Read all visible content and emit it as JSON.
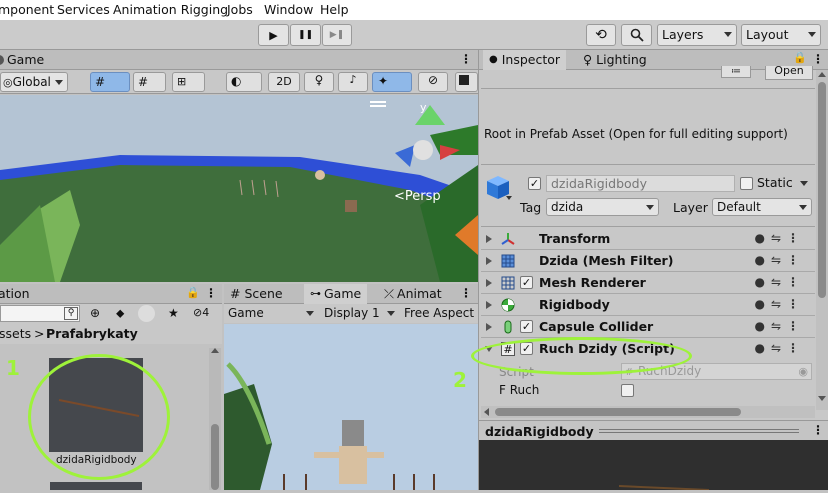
{
  "menu": [
    "mponent",
    "Services",
    "Animation Rigging",
    "Jobs",
    "Window",
    "Help"
  ],
  "toolbar": {
    "play": "▶",
    "pause": "❚❚",
    "step": "▶❚",
    "history": "⟲",
    "search": "🔍",
    "layers": "Layers",
    "layout": "Layout"
  },
  "game_view": {
    "tab": "Game",
    "pivot": "Global",
    "mode_2d": "2D",
    "persp": "<Persp",
    "gizmo_axis": "y"
  },
  "project": {
    "tab": "ation",
    "breadcrumb_root": "ssets",
    "breadcrumb_sep": ">",
    "breadcrumb_folder": "Prafabrykaty",
    "hidden_count": "4",
    "asset_name": "dzidaRigidbody",
    "annotation": "1"
  },
  "game2": {
    "tabs": [
      "Scene",
      "Game",
      "Animat"
    ],
    "display_mode": "Game",
    "display": "Display 1",
    "aspect": "Free Aspect"
  },
  "inspector": {
    "tabs": [
      "Inspector",
      "Lighting"
    ],
    "open_btn": "Open",
    "prefab_note": "Root in Prefab Asset (Open for full editing support)",
    "object_name": "dzidaRigidbody",
    "static_label": "Static",
    "tag_label": "Tag",
    "tag_value": "dzida",
    "layer_label": "Layer",
    "layer_value": "Default",
    "components": [
      {
        "name": "Transform",
        "icon": "transform-icon",
        "checkbox": false
      },
      {
        "name": "Dzida (Mesh Filter)",
        "icon": "mesh-filter-icon",
        "checkbox": false
      },
      {
        "name": "Mesh Renderer",
        "icon": "mesh-renderer-icon",
        "checkbox": true
      },
      {
        "name": "Rigidbody",
        "icon": "rigidbody-icon",
        "checkbox": false
      },
      {
        "name": "Capsule Collider",
        "icon": "capsule-collider-icon",
        "checkbox": true
      },
      {
        "name": "Ruch Dzidy (Script)",
        "icon": "script-icon",
        "checkbox": true
      }
    ],
    "script_label": "Script",
    "script_value": "RuchDzidy",
    "f_ruch_label": "F Ruch",
    "annotation": "2",
    "preview_title": "dzidaRigidbody"
  },
  "colors": {
    "highlight_ring": "#9ef23a",
    "water": "#2e4fd6",
    "terrain": "#3f6e3c",
    "sky": "#b4c4d4"
  }
}
